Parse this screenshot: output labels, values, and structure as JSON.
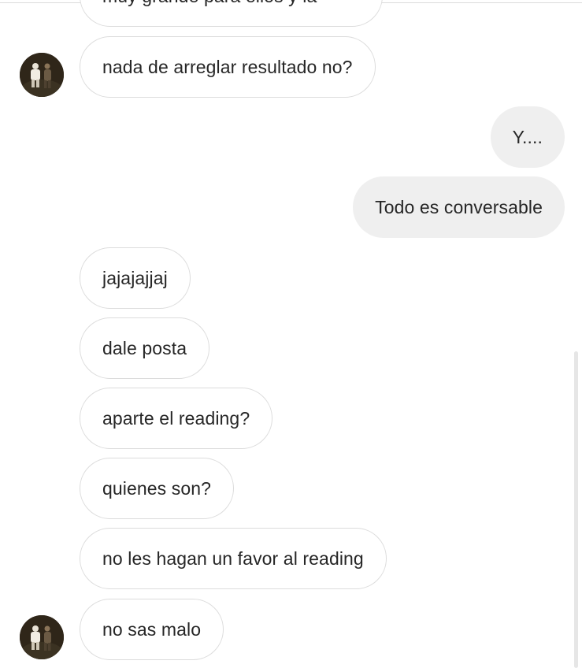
{
  "messages": [
    {
      "side": "in",
      "text": "muy grande para ellos y la"
    },
    {
      "side": "in",
      "text": "nada de arreglar resultado no?"
    },
    {
      "side": "out",
      "text": "Y...."
    },
    {
      "side": "out",
      "text": "Todo es conversable"
    },
    {
      "side": "in",
      "text": "jajajajjaj"
    },
    {
      "side": "in",
      "text": "dale posta"
    },
    {
      "side": "in",
      "text": "aparte el reading?"
    },
    {
      "side": "in",
      "text": "quienes son?"
    },
    {
      "side": "in",
      "text": "no les hagan un favor al reading"
    },
    {
      "side": "in",
      "text": "no sas malo"
    }
  ],
  "avatar": {
    "icon": "profile-photo-icon"
  },
  "colors": {
    "incoming_bg": "#ffffff",
    "incoming_border": "#dcdcdc",
    "outgoing_bg": "#efefef",
    "text": "#262626"
  }
}
